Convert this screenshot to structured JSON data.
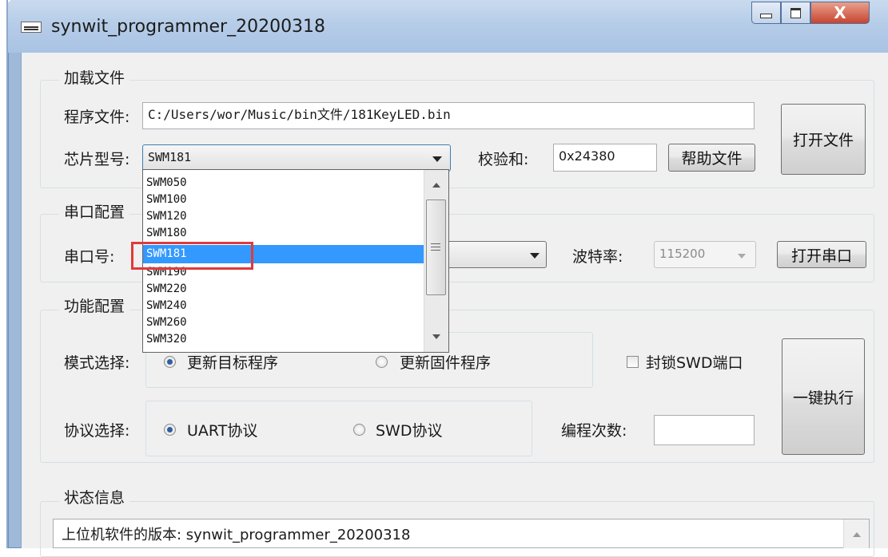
{
  "window": {
    "title": "synwit_programmer_20200318",
    "close_label": "X"
  },
  "file_group": {
    "title": "加载文件",
    "program_file_label": "程序文件:",
    "program_file_value": "C:/Users/wor/Music/bin文件/181KeyLED.bin",
    "open_file_button": "打开文件",
    "chip_label": "芯片型号:",
    "chip_selected": "SWM181",
    "checksum_label": "校验和:",
    "checksum_value": "0x24380",
    "help_button": "帮助文件"
  },
  "chip_dropdown": {
    "options": [
      "SWM050",
      "SWM100",
      "SWM120",
      "SWM180",
      "SWM181",
      "SWM190",
      "SWM220",
      "SWM240",
      "SWM260",
      "SWM320"
    ],
    "selected_index": 4
  },
  "serial_group": {
    "title": "串口配置",
    "port_label": "串口号:",
    "port_value": "",
    "baud_label": "波特率:",
    "baud_value": "115200",
    "open_port_button": "打开串口"
  },
  "function_group": {
    "title": "功能配置",
    "mode_label": "模式选择:",
    "mode_option_1": "更新目标程序",
    "mode_option_2": "更新固件程序",
    "lock_swd_label": "封锁SWD端口",
    "protocol_label": "协议选择:",
    "protocol_option_1": "UART协议",
    "protocol_option_2": "SWD协议",
    "program_count_label": "编程次数:",
    "program_count_value": "",
    "execute_button": "一键执行"
  },
  "status_group": {
    "title": "状态信息",
    "first_line": "上位机软件的版本: synwit_programmer_20200318"
  },
  "colors": {
    "selection": "#3399ff",
    "highlight_box": "#e03a3a",
    "title_bar": "#b6cde8"
  }
}
